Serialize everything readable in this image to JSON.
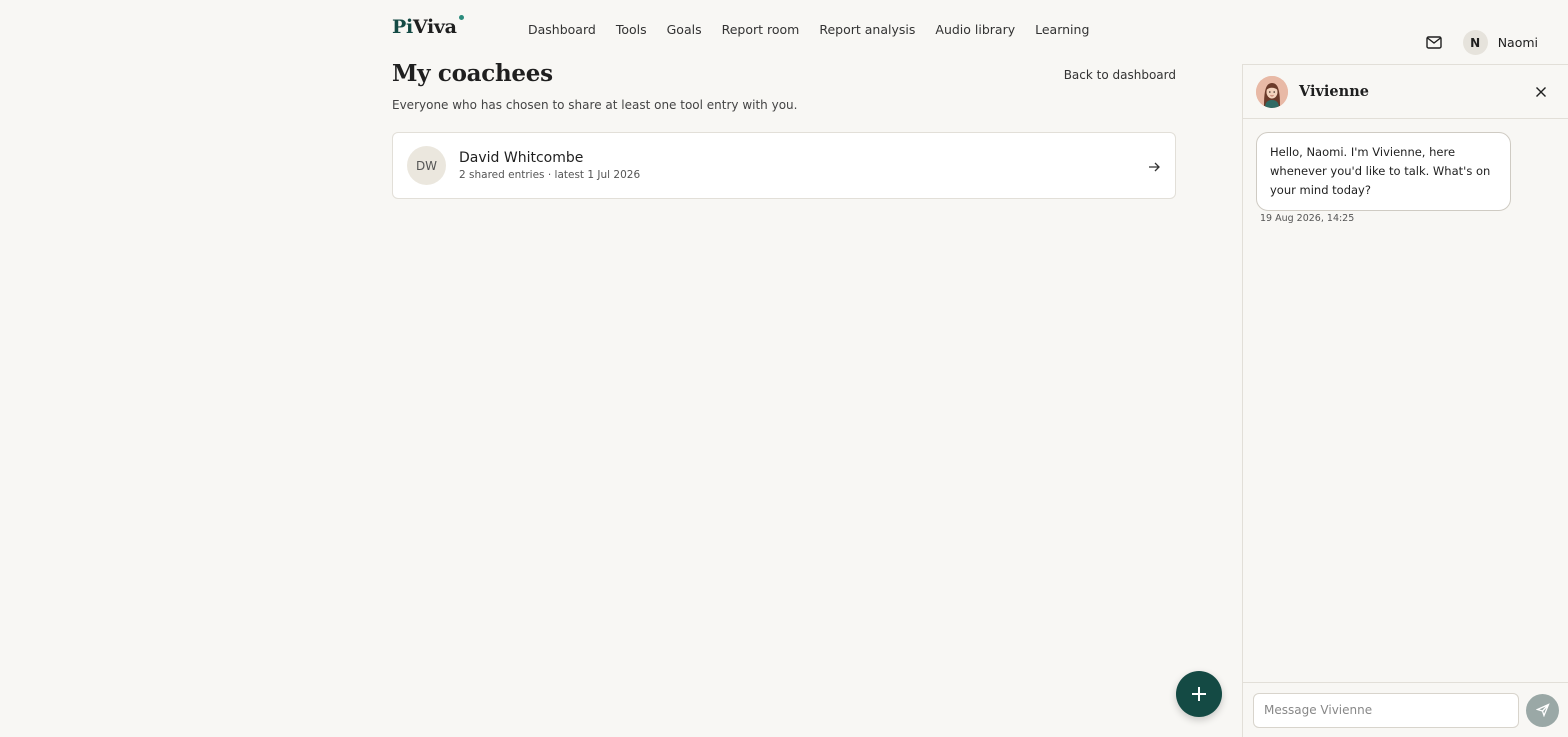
{
  "header": {
    "logo_prefix": "Pi",
    "logo_suffix": "Viva",
    "nav": [
      "Dashboard",
      "Tools",
      "Goals",
      "Report room",
      "Report analysis",
      "Audio library",
      "Learning"
    ],
    "user_initial": "N",
    "user_name": "Naomi",
    "icons": {
      "mail": "mail-icon"
    }
  },
  "main": {
    "title": "My coachees",
    "back_link": "Back to dashboard",
    "subtitle": "Everyone who has chosen to share at least one tool entry with you.",
    "coachees": [
      {
        "initials": "DW",
        "name": "David Whitcombe",
        "meta": "2 shared entries · latest 1 Jul 2026"
      }
    ]
  },
  "chat": {
    "name": "Vivienne",
    "messages": [
      {
        "text": "Hello, Naomi. I'm Vivienne, here whenever you'd like to talk. What's on your mind today?",
        "time": "19 Aug 2026, 14:25"
      }
    ],
    "input_placeholder": "Message Vivienne"
  },
  "colors": {
    "brand": "#144a44",
    "background": "#f8f7f4",
    "send_disabled": "#9aa8a6"
  }
}
